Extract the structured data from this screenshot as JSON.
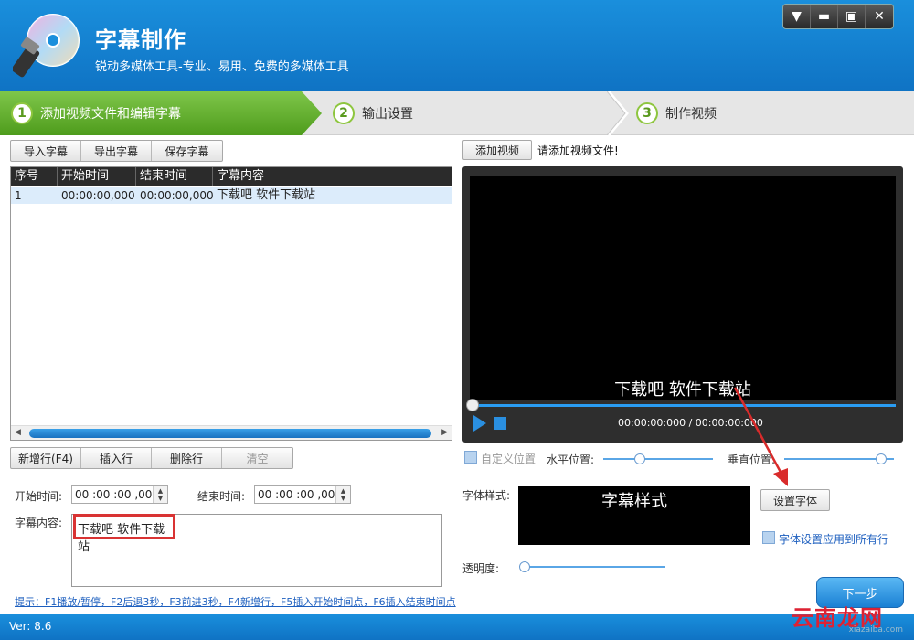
{
  "header": {
    "title": "字幕制作",
    "subtitle": "锐动多媒体工具-专业、易用、免费的多媒体工具",
    "window_controls": [
      "menu-icon",
      "minimize-icon",
      "maximize-icon",
      "close-icon"
    ]
  },
  "steps": [
    {
      "num": "1",
      "label": "添加视频文件和编辑字幕",
      "active": true
    },
    {
      "num": "2",
      "label": "输出设置",
      "active": false
    },
    {
      "num": "3",
      "label": "制作视频",
      "active": false
    }
  ],
  "subtitle_toolbar": {
    "import": "导入字幕",
    "export": "导出字幕",
    "save": "保存字幕"
  },
  "table": {
    "columns": [
      "序号",
      "开始时间",
      "结束时间",
      "字幕内容"
    ],
    "rows": [
      {
        "index": "1",
        "start": "00:00:00,000",
        "end": "00:00:00,000",
        "content": "下载吧 软件下载站"
      }
    ]
  },
  "row_actions": {
    "new_row": "新增行(F4)",
    "insert_row": "插入行",
    "delete_row": "删除行",
    "clear": "清空"
  },
  "editor": {
    "start_label": "开始时间:",
    "start_value": "00 :00 :00 ,000",
    "end_label": "结束时间:",
    "end_value": "00 :00 :00 ,000",
    "content_label": "字幕内容:",
    "content_value": "下载吧 软件下载站"
  },
  "hint": "提示：F1播放/暂停，F2后退3秒，F3前进3秒，F4新增行，F5插入开始时间点，F6插入结束时间点",
  "video": {
    "add_button": "添加视频",
    "status": "请添加视频文件!",
    "subtitle_overlay": "下载吧  软件下载站",
    "time": "00:00:00:000 / 00:00:00:000"
  },
  "position": {
    "custom_label": "自定义位置",
    "horizontal_label": "水平位置:",
    "vertical_label": "垂直位置:"
  },
  "font": {
    "style_label": "字体样式:",
    "preview_text": "字幕样式",
    "set_font_button": "设置字体",
    "apply_all_label": "字体设置应用到所有行",
    "opacity_label": "透明度:"
  },
  "next_button": "下一步",
  "version": "Ver: 8.6",
  "watermark": "云南龙网",
  "watermark_url": "xiazaiba.com",
  "colors": {
    "header_blue": "#1a8fdc",
    "step_green": "#6ab83a",
    "accent_blue": "#2a9cf2",
    "highlight_red": "#d93333"
  }
}
